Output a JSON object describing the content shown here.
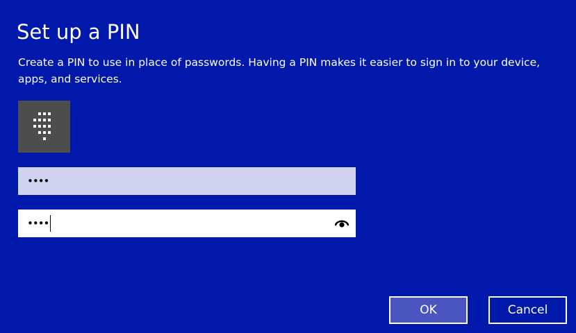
{
  "dialog": {
    "title": "Set up a PIN",
    "description": "Create a PIN to use in place of passwords. Having a PIN makes it easier to sign in to your device, apps, and services.",
    "pin_icon": "keypad-icon"
  },
  "fields": {
    "new_pin_value": "••••",
    "confirm_pin_value": "••••",
    "reveal_icon": "eye-icon"
  },
  "buttons": {
    "ok_label": "OK",
    "cancel_label": "Cancel"
  },
  "colors": {
    "background": "#0019ab",
    "tile": "#4d4d4d",
    "field_inactive": "#d0d3ef",
    "field_active": "#ffffff",
    "ok_button": "#4a55c2"
  }
}
